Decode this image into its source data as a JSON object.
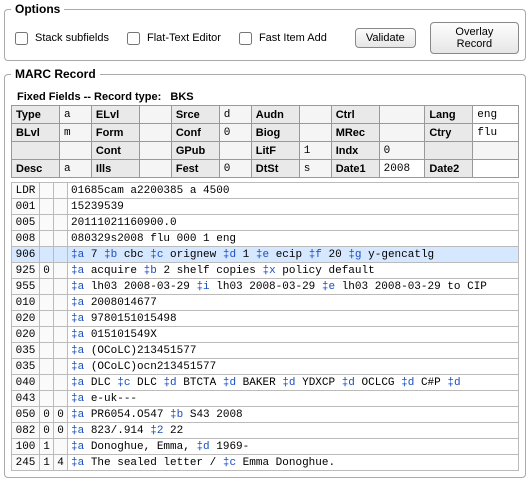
{
  "options": {
    "legend": "Options",
    "stack_subfields": "Stack subfields",
    "flat_text": "Flat-Text Editor",
    "fast_item": "Fast Item Add",
    "validate": "Validate",
    "overlay": "Overlay Record"
  },
  "marc": {
    "legend": "MARC Record",
    "ff_header_label": "Fixed Fields -- Record type:",
    "ff_header_value": "BKS",
    "fixed": {
      "r1": {
        "Type": "a",
        "ELvl": "",
        "Srce": "d",
        "Audn": "",
        "Ctrl": "",
        "Lang": "eng"
      },
      "r2": {
        "BLvl": "m",
        "Form": "",
        "Conf": "0",
        "Biog": "",
        "MRec": "",
        "Ctry": "flu"
      },
      "r3": {
        "_a": "",
        "Cont": "",
        "GPub": "",
        "LitF": "1",
        "Indx": "0",
        "_b": ""
      },
      "r4": {
        "Desc": "a",
        "Ills": "",
        "Fest": "0",
        "DtSt": "s",
        "Date1": "2008",
        "Date2": ""
      }
    }
  },
  "rows": [
    {
      "tag": "LDR",
      "i1": "",
      "i2": "",
      "data": [
        [
          "",
          "01685cam a2200385  a 4500"
        ]
      ]
    },
    {
      "tag": "001",
      "i1": "",
      "i2": "",
      "data": [
        [
          "",
          "15239539"
        ]
      ]
    },
    {
      "tag": "005",
      "i1": "",
      "i2": "",
      "data": [
        [
          "",
          "20111021160900.0"
        ]
      ]
    },
    {
      "tag": "008",
      "i1": "",
      "i2": "",
      "data": [
        [
          "",
          "080329s2008    flu           000 1 eng"
        ]
      ]
    },
    {
      "tag": "906",
      "i1": "",
      "i2": "",
      "hl": true,
      "data": [
        [
          "a",
          "7 "
        ],
        [
          "b",
          "cbc "
        ],
        [
          "c",
          "orignew "
        ],
        [
          "d",
          "1 "
        ],
        [
          "e",
          "ecip "
        ],
        [
          "f",
          "20 "
        ],
        [
          "g",
          "y-gencatlg"
        ]
      ]
    },
    {
      "tag": "925",
      "i1": "0",
      "i2": "",
      "data": [
        [
          "a",
          "acquire "
        ],
        [
          "b",
          "2 shelf copies "
        ],
        [
          "x",
          "policy default"
        ]
      ]
    },
    {
      "tag": "955",
      "i1": "",
      "i2": "",
      "data": [
        [
          "a",
          "lh03 2008-03-29 "
        ],
        [
          "i",
          "lh03 2008-03-29 "
        ],
        [
          "e",
          "lh03 2008-03-29 to CIP"
        ]
      ]
    },
    {
      "tag": "010",
      "i1": "",
      "i2": "",
      "data": [
        [
          "a",
          "  2008014677"
        ]
      ]
    },
    {
      "tag": "020",
      "i1": "",
      "i2": "",
      "data": [
        [
          "a",
          "9780151015498"
        ]
      ]
    },
    {
      "tag": "020",
      "i1": "",
      "i2": "",
      "data": [
        [
          "a",
          "015101549X"
        ]
      ]
    },
    {
      "tag": "035",
      "i1": "",
      "i2": "",
      "data": [
        [
          "a",
          "(OCoLC)213451577"
        ]
      ]
    },
    {
      "tag": "035",
      "i1": "",
      "i2": "",
      "data": [
        [
          "a",
          "(OCoLC)ocn213451577"
        ]
      ]
    },
    {
      "tag": "040",
      "i1": "",
      "i2": "",
      "data": [
        [
          "a",
          "DLC "
        ],
        [
          "c",
          "DLC "
        ],
        [
          "d",
          "BTCTA "
        ],
        [
          "d",
          "BAKER "
        ],
        [
          "d",
          "YDXCP "
        ],
        [
          "d",
          "OCLCG "
        ],
        [
          "d",
          "C#P "
        ],
        [
          "d",
          ""
        ]
      ]
    },
    {
      "tag": "043",
      "i1": "",
      "i2": "",
      "data": [
        [
          "a",
          "e-uk---"
        ]
      ]
    },
    {
      "tag": "050",
      "i1": "0",
      "i2": "0",
      "data": [
        [
          "a",
          "PR6054.O547 "
        ],
        [
          "b",
          "S43 2008"
        ]
      ]
    },
    {
      "tag": "082",
      "i1": "0",
      "i2": "0",
      "data": [
        [
          "a",
          "823/.914 "
        ],
        [
          "2",
          "22"
        ]
      ]
    },
    {
      "tag": "100",
      "i1": "1",
      "i2": "",
      "data": [
        [
          "a",
          "Donoghue, Emma, "
        ],
        [
          "d",
          "1969-"
        ]
      ]
    },
    {
      "tag": "245",
      "i1": "1",
      "i2": "4",
      "data": [
        [
          "a",
          "The sealed letter / "
        ],
        [
          "c",
          "Emma Donoghue."
        ]
      ]
    }
  ]
}
